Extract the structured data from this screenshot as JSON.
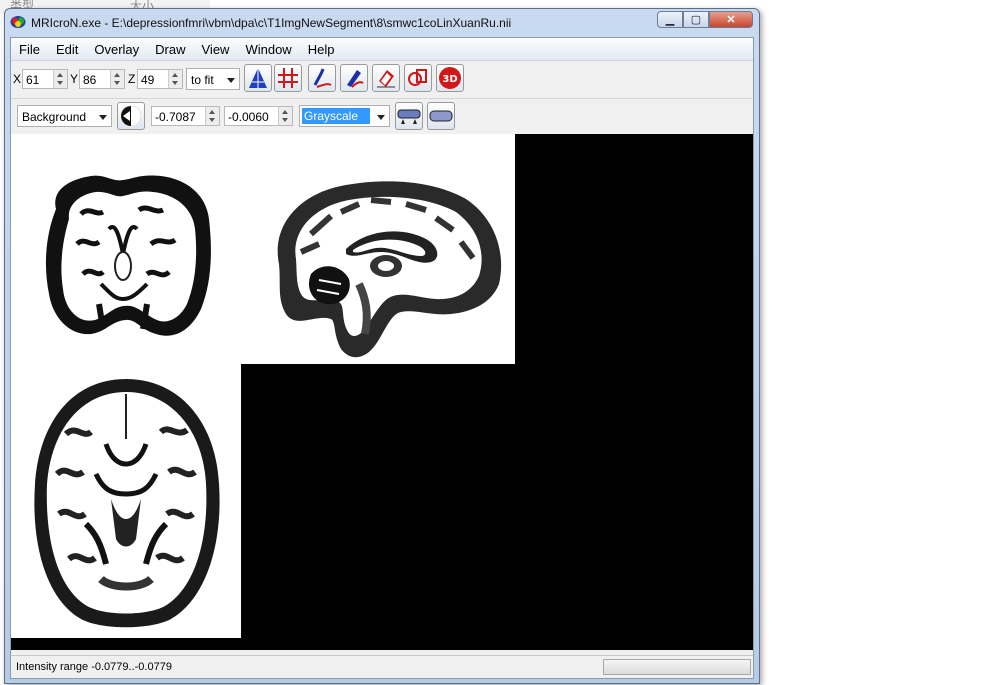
{
  "background_labels": [
    "类型",
    "大小"
  ],
  "window": {
    "title": "MRIcroN.exe - E:\\depressionfmri\\vbm\\dpa\\c\\T1ImgNewSegment\\8\\smwc1coLinXuanRu.nii",
    "min_glyph": "▁",
    "max_glyph": "▢",
    "close_glyph": "✕"
  },
  "menu": {
    "items": [
      "File",
      "Edit",
      "Overlay",
      "Draw",
      "View",
      "Window",
      "Help"
    ]
  },
  "coords": {
    "x_label": "X",
    "x_value": "61",
    "y_label": "Y",
    "y_value": "86",
    "z_label": "Z",
    "z_value": "49",
    "zoom_value": "to fit"
  },
  "toolbar_icons": [
    "triangle-xyz-icon",
    "crosshair-icon",
    "pen-draw-icon",
    "pen-fill-icon",
    "eraser-icon",
    "shape-icon",
    "render-3d-icon"
  ],
  "render_3d_label": "3D",
  "layer": {
    "layer_value": "Background",
    "min_intensity": "-0.7087",
    "max_intensity": "-0.0060",
    "colormap_value": "Grayscale"
  },
  "status": {
    "text": "Intensity range -0.0779..-0.0779",
    "progress": 0
  },
  "colors": {
    "viewer_background": "#000000",
    "pane_background": "#ffffff",
    "selection": "#3399ff",
    "close_button": "#c7452f"
  }
}
